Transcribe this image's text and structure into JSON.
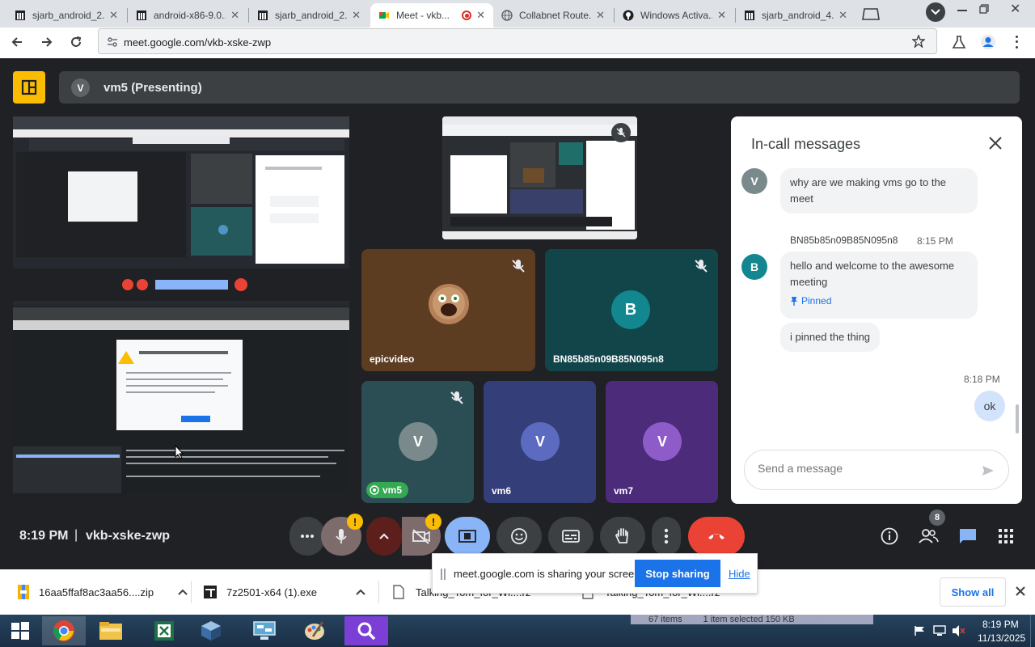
{
  "browser": {
    "tabs": [
      {
        "title": "sjarb_android_2..."
      },
      {
        "title": "android-x86-9.0..."
      },
      {
        "title": "sjarb_android_2..."
      },
      {
        "title": "Meet - vkb..."
      },
      {
        "title": "Collabnet Route..."
      },
      {
        "title": "Windows Activa..."
      },
      {
        "title": "sjarb_android_4..."
      }
    ],
    "url": "meet.google.com/vkb-xske-zwp"
  },
  "meet": {
    "presenter_initial": "V",
    "presenter_label": "vm5 (Presenting)",
    "tiles": [
      {
        "name": "epicvideo"
      },
      {
        "name": "BN85b85n09B85N095n8",
        "initial": "B"
      },
      {
        "name": "vm5",
        "initial": "V"
      },
      {
        "name": "vm6",
        "initial": "V"
      },
      {
        "name": "vm7",
        "initial": "V"
      }
    ],
    "time": "8:19 PM",
    "separator": "|",
    "meeting_code": "vkb-xske-zwp",
    "people_count": "8",
    "warn_mark": "!",
    "colors": {
      "accent": "#1a73e8",
      "end_call": "#ea4335",
      "presenting": "#8ab4f8"
    }
  },
  "chat": {
    "title": "In-call messages",
    "messages": [
      {
        "initial": "V",
        "text": "why are we making vms go to the meet"
      },
      {
        "sender": "BN85b85n09B85N095n8",
        "time": "8:15 PM",
        "initial": "B",
        "text": "hello and welcome to the awesome meeting",
        "pinned": "Pinned"
      },
      {
        "text": "i pinned the thing"
      },
      {
        "time": "8:18 PM",
        "text": "ok"
      }
    ],
    "input_placeholder": "Send a message"
  },
  "share_banner": {
    "text": "meet.google.com is sharing your screen.",
    "stop": "Stop sharing",
    "hide": "Hide"
  },
  "downloads": {
    "items": [
      {
        "name": "16aa5ffaf8ac3aa56....zip"
      },
      {
        "name": "7z2501-x64 (1).exe"
      },
      {
        "name": "Talking_Tom_for_Wi....rz"
      },
      {
        "name": "Talking_Tom_for_Wi....rz"
      }
    ],
    "show_all": "Show all"
  },
  "explorer_status": {
    "items": "67 items",
    "selected": "1 item selected  150 KB"
  },
  "taskbar": {
    "time": "8:19 PM",
    "date": "11/13/2025"
  }
}
